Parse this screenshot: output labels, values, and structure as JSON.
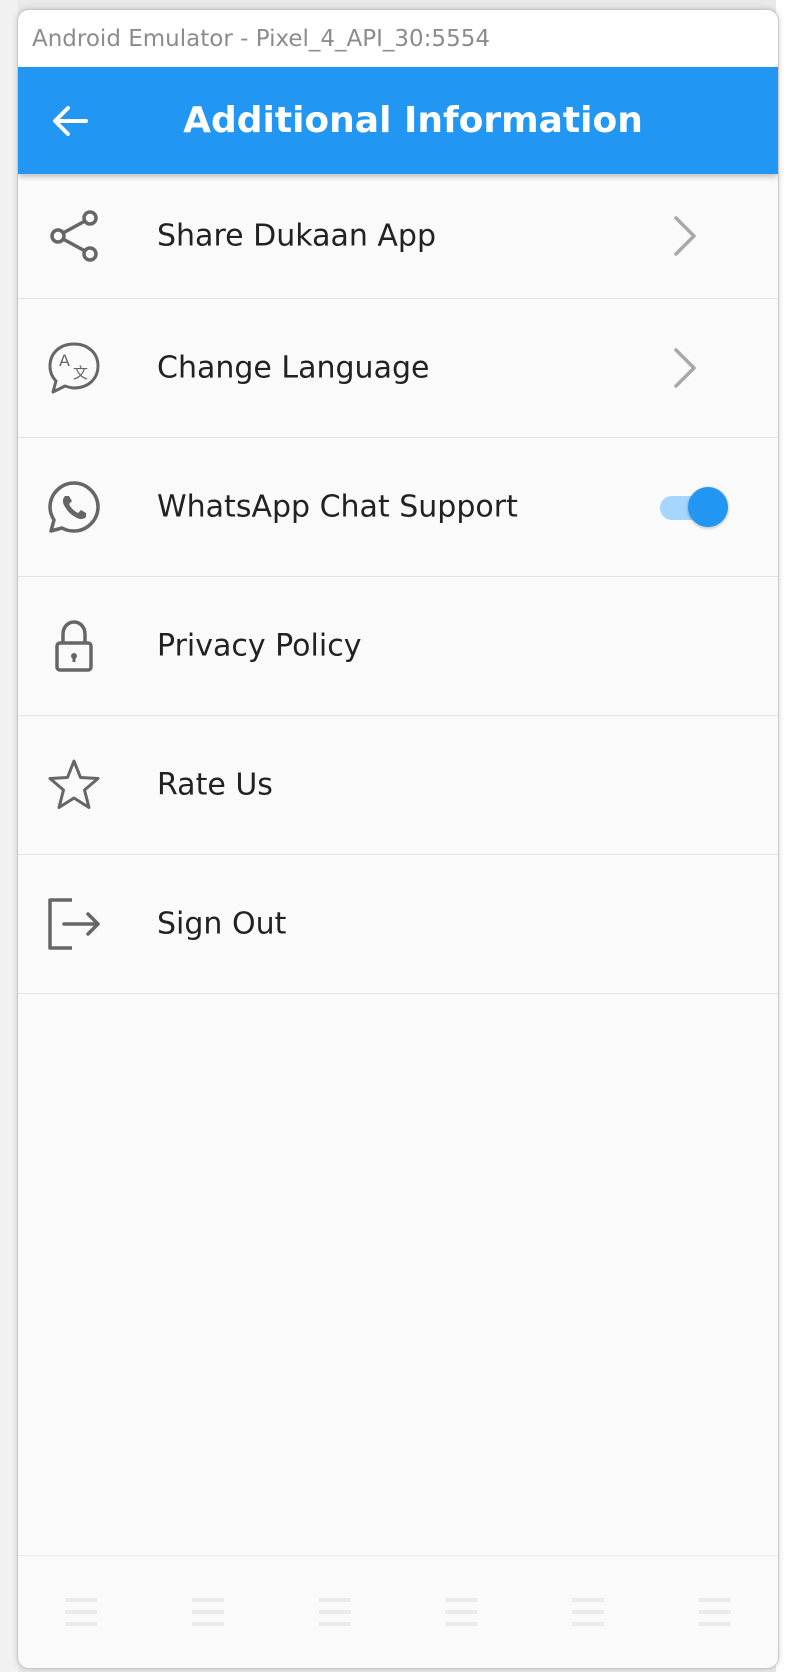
{
  "window": {
    "title": "Android Emulator - Pixel_4_API_30:5554"
  },
  "appbar": {
    "title": "Additional Information",
    "back_icon": "arrow-left-icon",
    "color": "#2196F3"
  },
  "menu": {
    "items": [
      {
        "label": "Share Dukaan App",
        "icon": "share-icon",
        "trailing": "chevron-right-icon"
      },
      {
        "label": "Change Language",
        "icon": "translate-icon",
        "trailing": "chevron-right-icon"
      },
      {
        "label": "WhatsApp Chat Support",
        "icon": "whatsapp-icon",
        "trailing": "toggle-switch",
        "toggle_on": true
      },
      {
        "label": "Privacy Policy",
        "icon": "lock-icon"
      },
      {
        "label": "Rate Us",
        "icon": "star-icon"
      },
      {
        "label": "Sign Out",
        "icon": "logout-icon"
      }
    ]
  },
  "bottom_nav": {
    "items": [
      {
        "icon": "list-icon"
      },
      {
        "icon": "list-icon"
      },
      {
        "icon": "list-icon"
      },
      {
        "icon": "list-icon"
      },
      {
        "icon": "list-icon"
      },
      {
        "icon": "list-icon"
      }
    ]
  }
}
